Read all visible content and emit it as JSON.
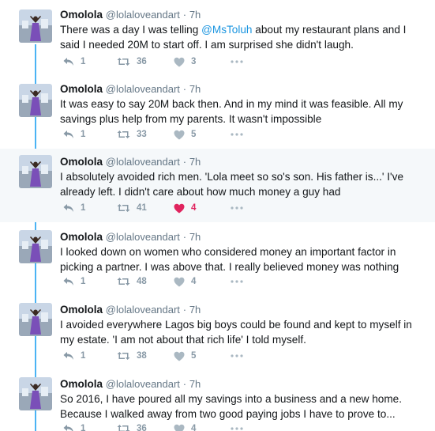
{
  "tweets": [
    {
      "name": "Omolola",
      "handle": "@lolaloveandart",
      "time": "7h",
      "text_before": "There was a day I was telling ",
      "mention": "@MsToluh",
      "text_after": " about my restaurant plans and I said I needed 20M to start off. I am surprised she didn't laugh.",
      "replies": "1",
      "retweets": "36",
      "likes": "3",
      "liked": false
    },
    {
      "name": "Omolola",
      "handle": "@lolaloveandart",
      "time": "7h",
      "text": "It was easy to say 20M back then. And in my mind it was feasible. All my savings plus help from my parents. It wasn't impossible",
      "replies": "1",
      "retweets": "33",
      "likes": "5",
      "liked": false
    },
    {
      "name": "Omolola",
      "handle": "@lolaloveandart",
      "time": "7h",
      "text": "I absolutely avoided rich men. 'Lola meet so so's son. His father is...' I've already left. I didn't care about how much money a guy had",
      "replies": "1",
      "retweets": "41",
      "likes": "4",
      "liked": true
    },
    {
      "name": "Omolola",
      "handle": "@lolaloveandart",
      "time": "7h",
      "text": "I looked down on women who considered money an important factor in picking a partner. I was above that. I really believed money was nothing",
      "replies": "1",
      "retweets": "48",
      "likes": "4",
      "liked": false
    },
    {
      "name": "Omolola",
      "handle": "@lolaloveandart",
      "time": "7h",
      "text": "I avoided everywhere Lagos big boys could be found and kept to myself in my estate. 'I am not about that rich life' I told myself.",
      "replies": "1",
      "retweets": "38",
      "likes": "5",
      "liked": false
    },
    {
      "name": "Omolola",
      "handle": "@lolaloveandart",
      "time": "7h",
      "text": "So 2016, I have poured all my savings into a business and a new home. Because I walked away from two good paying jobs I have to prove to...",
      "replies": "1",
      "retweets": "36",
      "likes": "4",
      "liked": false
    }
  ],
  "separator": "·",
  "icons": [
    "reply-icon",
    "retweet-icon",
    "like-icon",
    "more-icon"
  ],
  "colors": {
    "accent": "#1b95e0",
    "thread_line": "#4ab3f4",
    "like_active": "#e0245e",
    "muted": "#8899a6",
    "highlight_bg": "#f5f8fa"
  }
}
